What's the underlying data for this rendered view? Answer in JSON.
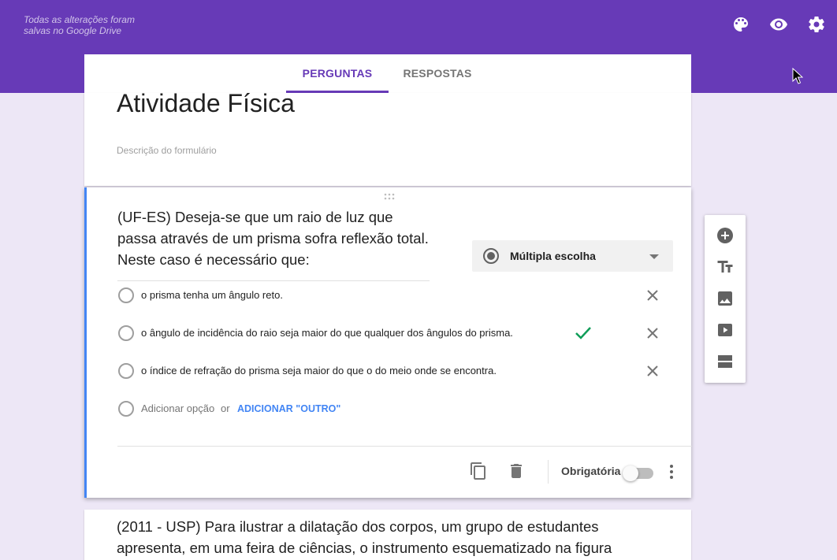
{
  "header": {
    "save_status": "Todas as alterações foram salvas no Google Drive",
    "icons": [
      "palette-icon",
      "preview-eye-icon",
      "settings-gear-icon"
    ],
    "color": "#673ab7"
  },
  "tabs": [
    {
      "label": "PERGUNTAS",
      "active": true
    },
    {
      "label": "RESPOSTAS",
      "active": false
    }
  ],
  "form": {
    "title": "Atividade Física",
    "description_placeholder": "Descrição do formulário"
  },
  "question": {
    "text": "(UF-ES) Deseja-se que um raio de luz que passa através de um prisma sofra reflexão total. Neste caso é necessário que:",
    "type": "Múltipla escolha",
    "options": [
      {
        "label": "o prisma tenha um ângulo reto.",
        "correct": false
      },
      {
        "label": "o ângulo de incidência do raio seja maior do que qualquer dos ângulos do prisma.",
        "correct": true
      },
      {
        "label": "o índice de refração do prisma seja maior do que o do meio onde se encontra.",
        "correct": false
      }
    ],
    "add_option": "Adicionar opção",
    "or": "or",
    "add_other": "ADICIONAR \"OUTRO\"",
    "required_label": "Obrigatória",
    "required": false,
    "accent_color": "#4285f4",
    "check_color": "#0f9d58"
  },
  "side_toolbar": {
    "items": [
      "add-question-icon",
      "add-title-icon",
      "add-image-icon",
      "add-video-icon",
      "add-section-icon"
    ]
  },
  "next_question": {
    "text": "(2011 - USP) Para ilustrar a dilatação dos corpos, um grupo de estudantes apresenta, em uma feira de ciências, o instrumento esquematizado na figura"
  }
}
